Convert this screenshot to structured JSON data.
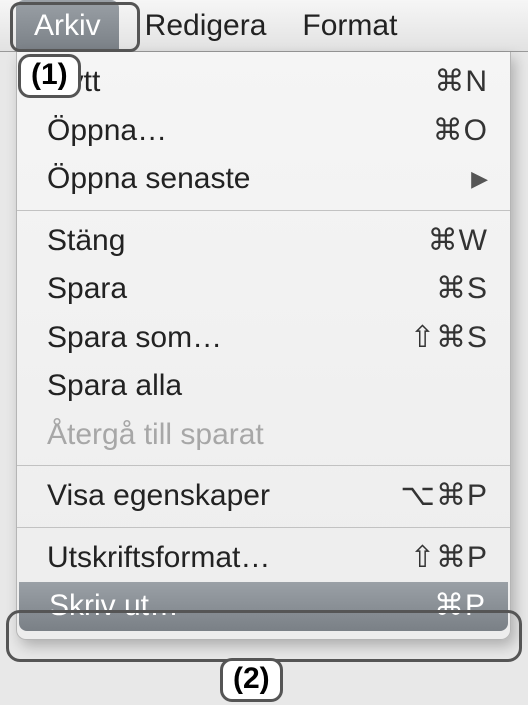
{
  "menubar": {
    "arkiv": "Arkiv",
    "redigera": "Redigera",
    "format": "Format"
  },
  "callouts": {
    "one": "(1)",
    "two": "(2)"
  },
  "menu": {
    "nytt": {
      "label": "Nytt",
      "shortcut": "⌘N"
    },
    "oppna": {
      "label": "Öppna…",
      "shortcut": "⌘O"
    },
    "oppna_senaste": {
      "label": "Öppna senaste"
    },
    "stang": {
      "label": "Stäng",
      "shortcut": "⌘W"
    },
    "spara": {
      "label": "Spara",
      "shortcut": "⌘S"
    },
    "spara_som": {
      "label": "Spara som…",
      "shortcut": "⇧⌘S"
    },
    "spara_alla": {
      "label": "Spara alla"
    },
    "aterga": {
      "label": "Återgå till sparat"
    },
    "visa_egenskaper": {
      "label": "Visa egenskaper",
      "shortcut": "⌥⌘P"
    },
    "utskriftsformat": {
      "label": "Utskriftsformat…",
      "shortcut": "⇧⌘P"
    },
    "skriv_ut": {
      "label": "Skriv ut…",
      "shortcut": "⌘P"
    }
  }
}
